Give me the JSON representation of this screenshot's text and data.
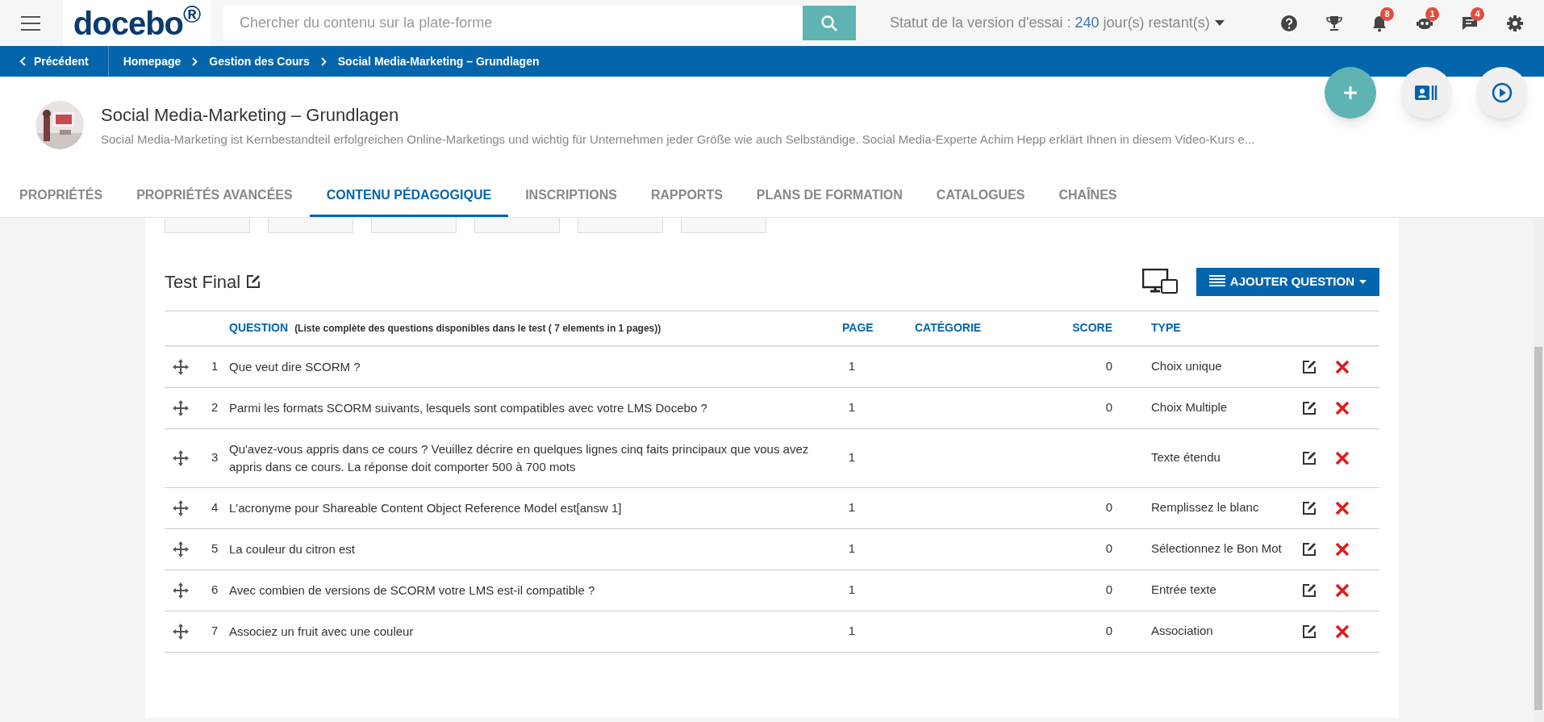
{
  "topbar": {
    "logo": "docebo$^{®}$",
    "search_placeholder": "Chercher du contenu sur la plate-forme",
    "trial_label": "Statut de la version d'essai :",
    "trial_days": "240",
    "trial_suffix": "jour(s) restant(s)",
    "badges": [
      {
        "kind": "bell",
        "count": "8"
      },
      {
        "kind": "robot",
        "count": "1"
      },
      {
        "kind": "chat",
        "count": "4"
      }
    ]
  },
  "breadcrumb": {
    "back": "Précédent",
    "items": [
      "Homepage",
      "Gestion des Cours",
      "Social Media-Marketing – Grundlagen"
    ]
  },
  "course": {
    "title": "Social Media-Marketing – Grundlagen",
    "description": "Social Media-Marketing ist Kernbestandteil erfolgreichen Online-Marketings und wichtig für Unternehmen jeder Größe wie auch Selbständige. Social Media-Experte Achim Hepp erklärt Ihnen in diesem Video-Kurs e..."
  },
  "tabs": [
    {
      "label": "PROPRIÉTÉS",
      "selected": false
    },
    {
      "label": "PROPRIÉTÉS AVANCÉES",
      "selected": false
    },
    {
      "label": "CONTENU PÉDAGOGIQUE",
      "selected": true
    },
    {
      "label": "INSCRIPTIONS",
      "selected": false
    },
    {
      "label": "RAPPORTS",
      "selected": false
    },
    {
      "label": "PLANS DE FORMATION",
      "selected": false
    },
    {
      "label": "CATALOGUES",
      "selected": false
    },
    {
      "label": "CHAÎNES",
      "selected": false
    }
  ],
  "test": {
    "title": "Test Final",
    "add_button": "AJOUTER QUESTION"
  },
  "table": {
    "columns": {
      "question": "QUESTION",
      "question_note": "(Liste complète des questions disponibles dans le test ( 7 elements in 1 pages))",
      "page": "PAGE",
      "category": "CATÉGORIE",
      "score": "SCORE",
      "type": "TYPE"
    },
    "rows": [
      {
        "number": "1",
        "question": "Que veut dire SCORM ?",
        "page": "1",
        "score": "0",
        "type": "Choix unique"
      },
      {
        "number": "2",
        "question": "Parmi les formats SCORM suivants, lesquels sont compatibles avec votre LMS Docebo ?",
        "page": "1",
        "score": "0",
        "type": "Choix Multiple"
      },
      {
        "number": "3",
        "question": "Qu'avez-vous appris dans ce cours ? Veuillez décrire en quelques lignes cinq faits principaux que vous avez appris dans ce cours. La réponse doit comporter 500 à 700 mots",
        "page": "1",
        "type": "Texte étendu"
      },
      {
        "number": "4",
        "question": "L'acronyme pour Shareable Content Object Reference Model est[answ 1]",
        "page": "1",
        "score": "0",
        "type": "Remplissez le blanc"
      },
      {
        "number": "5",
        "question": "La couleur du citron est",
        "page": "1",
        "score": "0",
        "type": "Sélectionnez le Bon Mot"
      },
      {
        "number": "6",
        "question": "Avec combien de versions de SCORM votre LMS est-il compatible ?",
        "page": "1",
        "score": "0",
        "type": "Entrée texte"
      },
      {
        "number": "7",
        "question": "Associez un fruit avec une couleur",
        "page": "1",
        "score": "0",
        "type": "Association"
      }
    ]
  }
}
